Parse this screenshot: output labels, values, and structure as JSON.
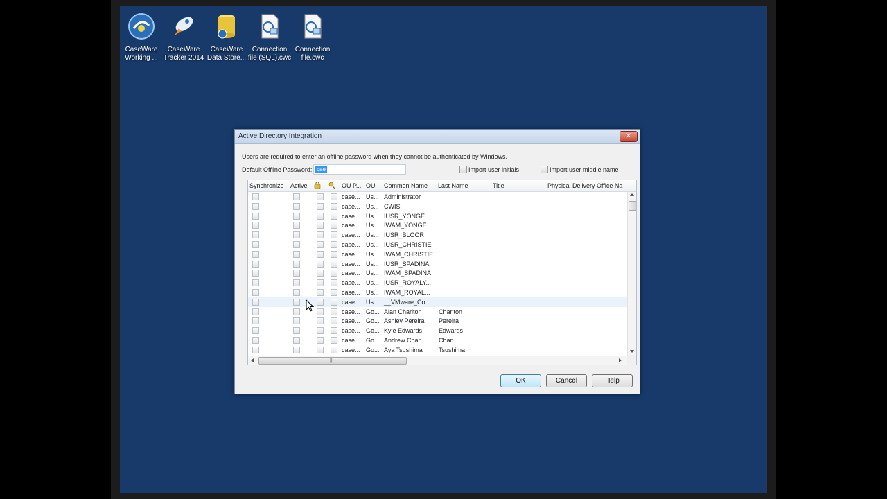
{
  "desktop_icons": [
    {
      "name": "caseware-working-papers",
      "line1": "CaseWare",
      "line2": "Working ..."
    },
    {
      "name": "caseware-tracker-2014",
      "line1": "CaseWare",
      "line2": "Tracker 2014"
    },
    {
      "name": "caseware-data-store",
      "line1": "CaseWare",
      "line2": "Data Store..."
    },
    {
      "name": "connection-file-sql",
      "line1": "Connection",
      "line2": "file (SQL).cwc"
    },
    {
      "name": "connection-file",
      "line1": "Connection",
      "line2": "file.cwc"
    }
  ],
  "dialog": {
    "title": "Active Directory Integration",
    "close_label": "✕",
    "info_text": "Users are required to enter an offline password when they cannot be authenticated by Windows.",
    "password_label": "Default Offline Password:",
    "password_value": "cae",
    "import_initials_label": "Import user initials",
    "import_middle_label": "Import user middle name",
    "ok_label": "OK",
    "cancel_label": "Cancel",
    "help_label": "Help",
    "grip": "|||"
  },
  "grid": {
    "headers": {
      "synchronize": "Synchronize",
      "active": "Active",
      "ou_path": "OU P...",
      "ou": "OU",
      "common_name": "Common Name",
      "last_name": "Last Name",
      "title": "Title",
      "physical_office": "Physical Delivery Office Na"
    },
    "rows": [
      {
        "ou_path": "case...",
        "ou": "Us...",
        "common_name": "Administrator",
        "last_name": ""
      },
      {
        "ou_path": "case...",
        "ou": "Us...",
        "common_name": "CWIS",
        "last_name": ""
      },
      {
        "ou_path": "case...",
        "ou": "Us...",
        "common_name": "IUSR_YONGE",
        "last_name": ""
      },
      {
        "ou_path": "case...",
        "ou": "Us...",
        "common_name": "IWAM_YONGE",
        "last_name": ""
      },
      {
        "ou_path": "case...",
        "ou": "Us...",
        "common_name": "IUSR_BLOOR",
        "last_name": ""
      },
      {
        "ou_path": "case...",
        "ou": "Us...",
        "common_name": "IUSR_CHRISTIE",
        "last_name": ""
      },
      {
        "ou_path": "case...",
        "ou": "Us...",
        "common_name": "IWAM_CHRISTIE",
        "last_name": ""
      },
      {
        "ou_path": "case...",
        "ou": "Us...",
        "common_name": "IUSR_SPADINA",
        "last_name": ""
      },
      {
        "ou_path": "case...",
        "ou": "Us...",
        "common_name": "IWAM_SPADINA",
        "last_name": ""
      },
      {
        "ou_path": "case...",
        "ou": "Us...",
        "common_name": "IUSR_ROYALY...",
        "last_name": ""
      },
      {
        "ou_path": "case...",
        "ou": "Us...",
        "common_name": "IWAM_ROYAL...",
        "last_name": ""
      },
      {
        "ou_path": "case...",
        "ou": "Us...",
        "common_name": "__VMware_Co...",
        "last_name": ""
      },
      {
        "ou_path": "case...",
        "ou": "Go...",
        "common_name": "Alan Charlton",
        "last_name": "Charlton"
      },
      {
        "ou_path": "case...",
        "ou": "Go...",
        "common_name": "Ashley Pereira",
        "last_name": "Pereira"
      },
      {
        "ou_path": "case...",
        "ou": "Go...",
        "common_name": "Kyle Edwards",
        "last_name": "Edwards"
      },
      {
        "ou_path": "case...",
        "ou": "Go...",
        "common_name": "Andrew Chan",
        "last_name": "Chan"
      },
      {
        "ou_path": "case...",
        "ou": "Go...",
        "common_name": "Aya Tsushima",
        "last_name": "Tsushima"
      }
    ],
    "highlighted_row": 11
  }
}
